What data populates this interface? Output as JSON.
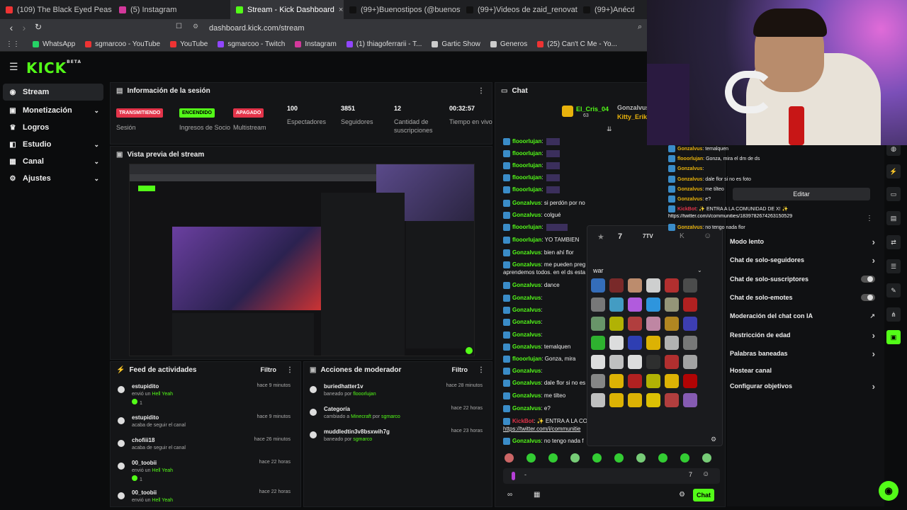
{
  "browser": {
    "tabs": [
      {
        "label": "(109) The Black Eyed Peas - I Got",
        "color": "#e33"
      },
      {
        "label": "(5) Instagram",
        "color": "#d3389b"
      },
      {
        "label": "Stream - Kick Dashboard",
        "color": "#53fc18",
        "active": true
      },
      {
        "label": "(99+)Buenostipos (@buenostipos) | T",
        "color": "#111"
      },
      {
        "label": "(99+)Videos de zaid_renovato06 (@",
        "color": "#111"
      },
      {
        "label": "(99+)Anécdota Div",
        "color": "#111"
      }
    ],
    "url": "dashboard.kick.com/stream",
    "bookmarks": [
      {
        "label": "WhatsApp",
        "color": "#25d366"
      },
      {
        "label": "sgmarcoo - YouTube",
        "color": "#e33"
      },
      {
        "label": "YouTube",
        "color": "#e33"
      },
      {
        "label": "sgmarcoo - Twitch",
        "color": "#9146ff"
      },
      {
        "label": "Instagram",
        "color": "#d3389b"
      },
      {
        "label": "(1) thiagoferrarii - T...",
        "color": "#9146ff"
      },
      {
        "label": "Gartic Show",
        "color": "#ccc"
      },
      {
        "label": "Generos",
        "color": "#ccc"
      },
      {
        "label": "(25) Can't C Me - Yo...",
        "color": "#e33"
      }
    ]
  },
  "app": {
    "logo": "KICK",
    "logo_sup": "BETA"
  },
  "sidebar": {
    "items": [
      {
        "label": "Stream",
        "icon": "broadcast-icon"
      },
      {
        "label": "Monetización",
        "icon": "money-icon"
      },
      {
        "label": "Logros",
        "icon": "trophy-icon"
      },
      {
        "label": "Estudio",
        "icon": "studio-icon"
      },
      {
        "label": "Canal",
        "icon": "channel-icon"
      },
      {
        "label": "Ajustes",
        "icon": "gear-icon"
      }
    ]
  },
  "session": {
    "title": "Información de la sesión",
    "badges": [
      {
        "badge": "TRANSMITIENDO",
        "label": "Sesión",
        "color": "#e3344a"
      },
      {
        "badge": "ENCENDIDO",
        "label": "Ingresos de Socio",
        "color": "#53fc18"
      },
      {
        "badge": "APAGADO",
        "label": "Multistream",
        "color": "#e3344a"
      }
    ],
    "stats": [
      {
        "value": "100",
        "label": "Espectadores"
      },
      {
        "value": "3851",
        "label": "Seguidores"
      },
      {
        "value": "12",
        "label": "Cantidad de suscripciones"
      },
      {
        "value": "00:32:57",
        "label": "Tiempo en vivo"
      }
    ]
  },
  "preview": {
    "title": "Vista previa del stream"
  },
  "activity": {
    "title": "Feed de actividades",
    "filter": "Filtro",
    "rows": [
      {
        "user": "estupidito",
        "action": "envió un",
        "item": "Hell Yeah",
        "count": "1",
        "time": "hace 9 minutos"
      },
      {
        "user": "estupidito",
        "action": "acaba de seguir el canal",
        "time": "hace 9 minutos"
      },
      {
        "user": "chofiii18",
        "action": "acaba de seguir el canal",
        "time": "hace 26 minutos"
      },
      {
        "user": "00_toobii",
        "action": "envió un",
        "item": "Hell Yeah",
        "count": "1",
        "time": "hace 22 horas"
      },
      {
        "user": "00_toobii",
        "action": "envió un",
        "item": "Hell Yeah",
        "time": "hace 22 horas"
      }
    ]
  },
  "moderator": {
    "title": "Acciones de moderador",
    "filter": "Filtro",
    "rows": [
      {
        "title": "buriedhatter1v",
        "sub": "baneado por",
        "by": "flooorlujan",
        "time": "hace 28 minutos"
      },
      {
        "title": "Categoría",
        "sub": "cambiado a",
        "target": "Minecraft",
        "by_label": "por",
        "by": "sgmarco",
        "time": "hace 22 horas"
      },
      {
        "title": "muddledtin3v8bsxwih7g",
        "sub": "baneado por",
        "by": "sgmarco",
        "time": "hace 23 horas"
      }
    ]
  },
  "chat": {
    "title": "Chat",
    "pinned": {
      "user": "El_Cris_04",
      "count": "63",
      "others": [
        "Gonzalvus",
        "Kitty_Erika"
      ]
    },
    "lines": [
      {
        "user": "flooorlujan",
        "msg": ""
      },
      {
        "user": "flooorlujan",
        "msg": ""
      },
      {
        "user": "flooorlujan",
        "msg": ""
      },
      {
        "user": "flooorlujan",
        "msg": ""
      },
      {
        "user": "flooorlujan",
        "msg": ""
      },
      {
        "user": "Gonzalvus",
        "msg": "si perdón por no entrar a ese stream"
      },
      {
        "user": "Gonzalvus",
        "msg": "colgué"
      },
      {
        "user": "flooorlujan",
        "msg": ""
      },
      {
        "user": "flooorlujan",
        "msg": "YO TAMBIEN"
      },
      {
        "user": "Gonzalvus",
        "msg": "bien ahí flor"
      },
      {
        "user": "Gonzalvus",
        "msg": "me pueden preg"
      },
      {
        "user": "",
        "msg": "aprendemos todos. en el ds esta"
      },
      {
        "user": "Gonzalvus",
        "msg": "dance"
      },
      {
        "user": "Gonzalvus",
        "msg": ""
      },
      {
        "user": "Gonzalvus",
        "msg": ""
      },
      {
        "user": "Gonzalvus",
        "msg": ""
      },
      {
        "user": "Gonzalvus",
        "msg": ""
      },
      {
        "user": "Gonzalvus",
        "msg": "temalquen"
      },
      {
        "user": "flooorlujan",
        "msg": "Gonza, mira"
      },
      {
        "user": "Gonzalvus",
        "msg": ""
      },
      {
        "user": "Gonzalvus",
        "msg": "dale flor si no es"
      },
      {
        "user": "Gonzalvus",
        "msg": "me tilteo"
      },
      {
        "user": "Gonzalvus",
        "msg": "e?"
      },
      {
        "user": "KickBot",
        "msg": "✨ ENTRA A LA CO"
      },
      {
        "user": "",
        "msg": "https://twitter.com/i/communitie"
      },
      {
        "user": "Gonzalvus",
        "msg": "no tengo nada f"
      }
    ],
    "send": "Chat",
    "emote_tabs": [
      "7TV"
    ],
    "emote_search": "war"
  },
  "overlay_chat": {
    "lines": [
      {
        "user": "Gonzalvus",
        "msg": "temalquen"
      },
      {
        "user": "flooorlujan",
        "msg": "Gonza, mira el dm de ds"
      },
      {
        "user": "Gonzalvus",
        "msg": ""
      },
      {
        "user": "Gonzalvus",
        "msg": "dale flor si no es foto"
      },
      {
        "user": "Gonzalvus",
        "msg": "me tilteo"
      },
      {
        "user": "Gonzalvus",
        "msg": "e?"
      },
      {
        "user": "KickBot",
        "msg": "✨ ENTRA A LA COMUNIDAD DE X! ✨"
      },
      {
        "user": "",
        "msg": "https://twitter.com/i/communities/1839782674263150529"
      },
      {
        "user": "Gonzalvus",
        "msg": "no tengo nada flor"
      }
    ]
  },
  "settings": {
    "edit": "Editar",
    "rows": [
      {
        "label": "Modo lento",
        "kind": "chevron"
      },
      {
        "label": "Chat de solo-seguidores",
        "kind": "chevron"
      },
      {
        "label": "Chat de solo-suscriptores",
        "kind": "toggle"
      },
      {
        "label": "Chat de solo-emotes",
        "kind": "toggle"
      },
      {
        "label": "Moderación del chat con IA",
        "kind": "link"
      },
      {
        "label": "Restricción de edad",
        "kind": "chevron"
      },
      {
        "label": "Palabras baneadas",
        "kind": "chevron"
      },
      {
        "label": "Hostear canal",
        "kind": "none"
      },
      {
        "label": "Configurar objetivos",
        "kind": "chevron"
      }
    ]
  }
}
